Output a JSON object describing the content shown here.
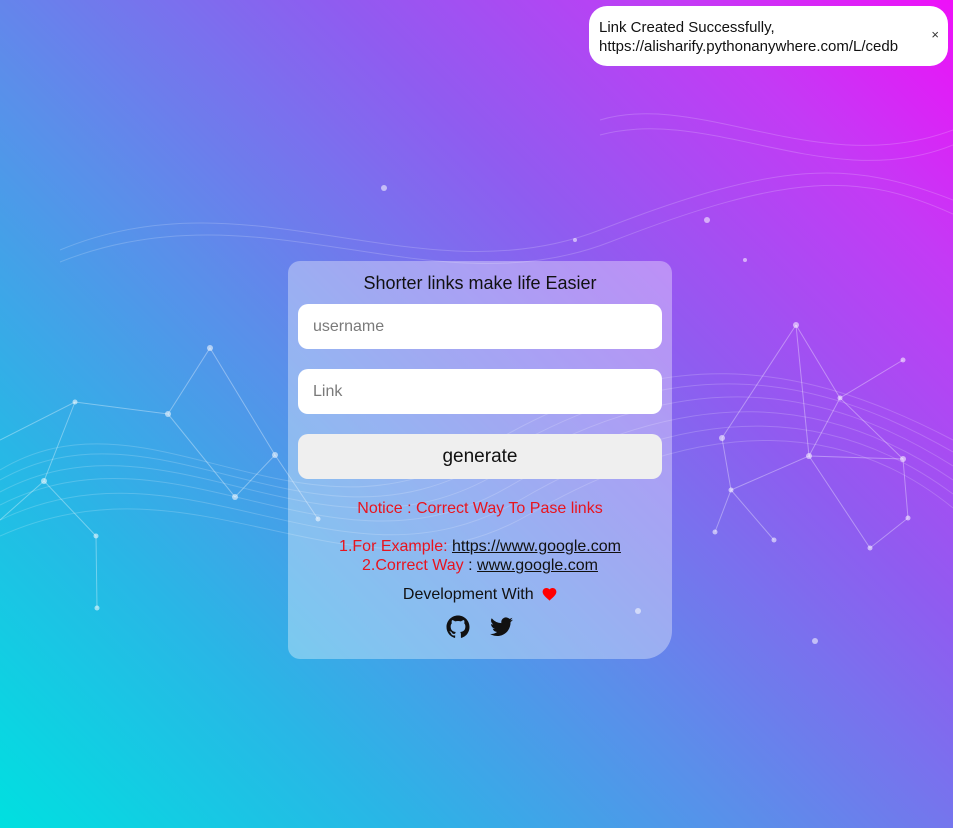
{
  "toast": {
    "message_line1": "Link Created Successfully,",
    "message_line2": "https://alisharify.pythonanywhere.com/L/cedb",
    "close_label": "×"
  },
  "card": {
    "title": "Shorter links make life Easier",
    "username_placeholder": "username",
    "username_value": "",
    "link_placeholder": "Link",
    "link_value": "",
    "generate_label": "generate",
    "notice": "Notice : Correct Way To Pase links",
    "example1_label": "1.For Example:",
    "example1_link": "https://www.google.com",
    "example2_label": "2.Correct Way",
    "example2_sep": ":",
    "example2_link": "www.google.com",
    "development_text": "Development With"
  },
  "icons": {
    "heart": "heart-icon",
    "github": "github-icon",
    "twitter": "twitter-icon",
    "close": "close-icon"
  },
  "colors": {
    "notice_red": "#e8141e",
    "gradient_start": "#00e0e0",
    "gradient_end": "#ee10f8",
    "heart_red": "#ff0000"
  }
}
